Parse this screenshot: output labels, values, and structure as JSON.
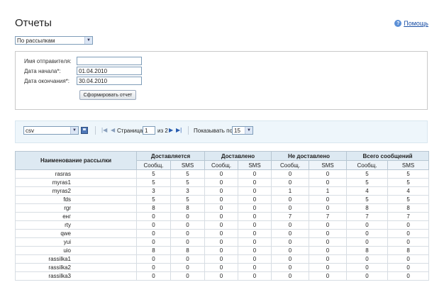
{
  "page": {
    "title": "Отчеты",
    "help_label": "Помощь",
    "help_icon": "help-icon"
  },
  "report_type": {
    "selected": "По рассылкам"
  },
  "form": {
    "sender_label": "Имя отправителя:",
    "sender_value": "",
    "start_label": "Дата начала*:",
    "start_value": "01.04.2010",
    "end_label": "Дата окончания*:",
    "end_value": "30.04.2010",
    "generate_label": "Сформировать отчет"
  },
  "toolbar": {
    "format_selected": "csv",
    "page_label": "Страница",
    "page_value": "1",
    "of_label": "из 2",
    "per_page_label": "Показывать по",
    "per_page_selected": "15"
  },
  "table": {
    "name_header": "Наименование рассылки",
    "groups": [
      "Доставляется",
      "Доставлено",
      "Не доставлено",
      "Всего сообщений"
    ],
    "sub_headers": [
      "Сообщ.",
      "SMS"
    ],
    "rows": [
      {
        "name": "rasras",
        "v": [
          "5",
          "5",
          "0",
          "0",
          "0",
          "0",
          "5",
          "5"
        ]
      },
      {
        "name": "myras1",
        "v": [
          "5",
          "5",
          "0",
          "0",
          "0",
          "0",
          "5",
          "5"
        ]
      },
      {
        "name": "myras2",
        "v": [
          "3",
          "3",
          "0",
          "0",
          "1",
          "1",
          "4",
          "4"
        ]
      },
      {
        "name": "fds",
        "v": [
          "5",
          "5",
          "0",
          "0",
          "0",
          "0",
          "5",
          "5"
        ]
      },
      {
        "name": "rgr",
        "v": [
          "8",
          "8",
          "0",
          "0",
          "0",
          "0",
          "8",
          "8"
        ]
      },
      {
        "name": "енг",
        "v": [
          "0",
          "0",
          "0",
          "0",
          "7",
          "7",
          "7",
          "7"
        ]
      },
      {
        "name": "rty",
        "v": [
          "0",
          "0",
          "0",
          "0",
          "0",
          "0",
          "0",
          "0"
        ]
      },
      {
        "name": "qwe",
        "v": [
          "0",
          "0",
          "0",
          "0",
          "0",
          "0",
          "0",
          "0"
        ]
      },
      {
        "name": "yui",
        "v": [
          "0",
          "0",
          "0",
          "0",
          "0",
          "0",
          "0",
          "0"
        ]
      },
      {
        "name": "uio",
        "v": [
          "8",
          "8",
          "0",
          "0",
          "0",
          "0",
          "8",
          "8"
        ]
      },
      {
        "name": "rassilka1",
        "v": [
          "0",
          "0",
          "0",
          "0",
          "0",
          "0",
          "0",
          "0"
        ]
      },
      {
        "name": "rassilka2",
        "v": [
          "0",
          "0",
          "0",
          "0",
          "0",
          "0",
          "0",
          "0"
        ]
      },
      {
        "name": "rassilka3",
        "v": [
          "0",
          "0",
          "0",
          "0",
          "0",
          "0",
          "0",
          "0"
        ]
      }
    ]
  }
}
